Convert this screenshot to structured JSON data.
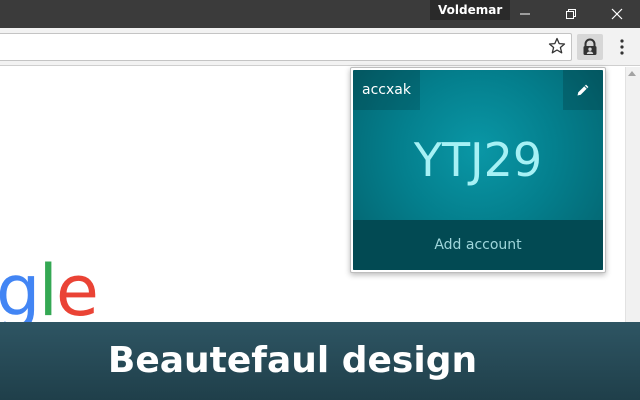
{
  "window": {
    "profile_name": "Voldemar"
  },
  "toolbar": {
    "star_icon": "star-icon",
    "extension_icon": "lock-user-icon",
    "menu_icon": "kebab-menu-icon"
  },
  "page": {
    "logo_fragment": [
      "g",
      "l",
      "e"
    ]
  },
  "popup": {
    "account_name": "accxak",
    "code": "YTJ29",
    "add_account_label": "Add account",
    "colors": {
      "accent": "#047f8d",
      "footer": "#024a53",
      "code_text": "#a6f1f5"
    }
  },
  "banner": {
    "text": "Beautefaul design"
  }
}
